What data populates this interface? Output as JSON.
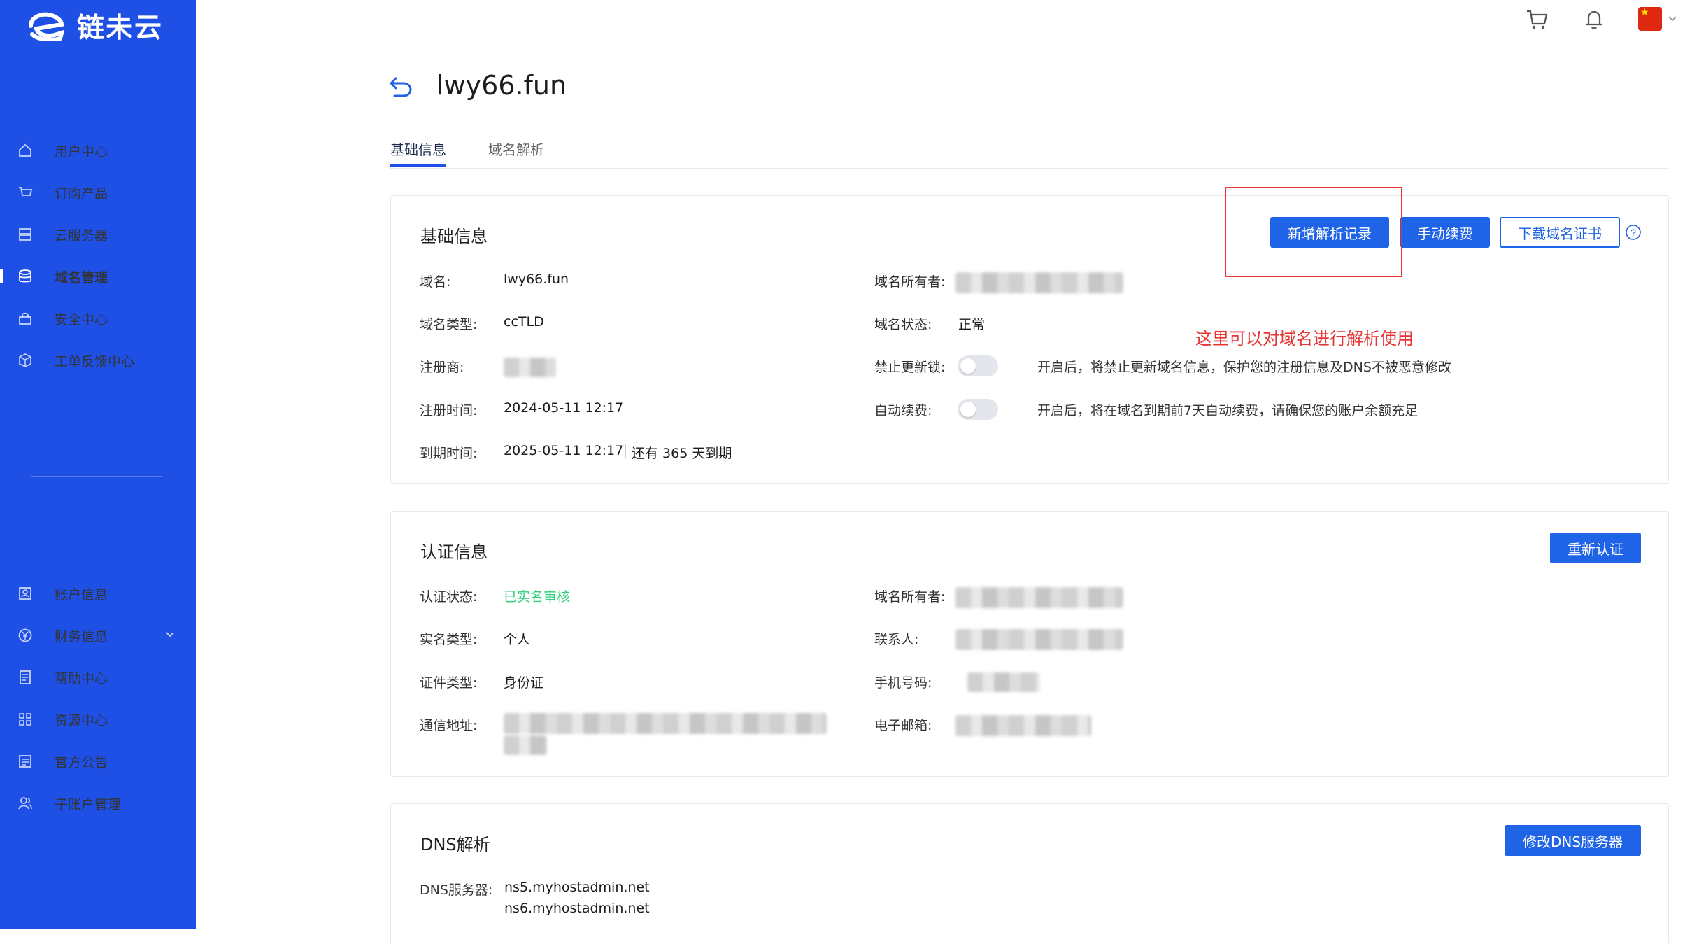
{
  "brand": {
    "name": "链未云"
  },
  "sidebar": {
    "items": [
      {
        "label": "用户中心",
        "icon": "home-icon"
      },
      {
        "label": "订购产品",
        "icon": "cart-icon"
      },
      {
        "label": "云服务器",
        "icon": "server-icon"
      },
      {
        "label": "域名管理",
        "icon": "database-icon",
        "active": true
      },
      {
        "label": "安全中心",
        "icon": "lock-icon"
      },
      {
        "label": "工单反馈中心",
        "icon": "cube-icon"
      }
    ],
    "bottom_items": [
      {
        "label": "账户信息",
        "icon": "id-card-icon"
      },
      {
        "label": "财务信息",
        "icon": "yuan-icon"
      },
      {
        "label": "帮助中心",
        "icon": "document-icon"
      },
      {
        "label": "资源中心",
        "icon": "grid-icon"
      },
      {
        "label": "官方公告",
        "icon": "notice-icon"
      },
      {
        "label": "子账户管理",
        "icon": "user-group-icon"
      }
    ]
  },
  "page": {
    "title": "lwy66.fun",
    "tabs": [
      {
        "label": "基础信息",
        "active": true
      },
      {
        "label": "域名解析"
      }
    ]
  },
  "basic": {
    "title": "基础信息",
    "buttons": {
      "add_record": "新增解析记录",
      "renew": "手动续费",
      "download_cert": "下载域名证书"
    },
    "fields": {
      "domain_label": "域名:",
      "domain_value": "lwy66.fun",
      "type_label": "域名类型:",
      "type_value": "ccTLD",
      "registrar_label": "注册商:",
      "reg_time_label": "注册时间:",
      "reg_time_value": "2024-05-11 12:17",
      "exp_time_label": "到期时间:",
      "exp_time_value": "2025-05-11 12:17",
      "remaining": "还有 365 天到期",
      "owner_label": "域名所有者:",
      "status_label": "域名状态:",
      "status_value": "正常",
      "lock_label": "禁止更新锁:",
      "lock_hint": "开启后，将禁止更新域名信息，保护您的注册信息及DNS不被恶意修改",
      "auto_label": "自动续费:",
      "auto_hint": "开启后，将在域名到期前7天自动续费，请确保您的账户余额充足"
    }
  },
  "annotation": {
    "text": "这里可以对域名进行解析使用",
    "color": "#e53535"
  },
  "auth": {
    "title": "认证信息",
    "button": "重新认证",
    "fields": {
      "status_label": "认证状态:",
      "status_value": "已实名审核",
      "type_label": "实名类型:",
      "type_value": "个人",
      "id_type_label": "证件类型:",
      "id_type_value": "身份证",
      "address_label": "通信地址:",
      "owner_label": "域名所有者:",
      "contact_label": "联系人:",
      "phone_label": "手机号码:",
      "email_label": "电子邮箱:"
    }
  },
  "dns": {
    "title": "DNS解析",
    "button": "修改DNS服务器",
    "server_label": "DNS服务器:",
    "servers": [
      "ns5.myhostadmin.net",
      "ns6.myhostadmin.net"
    ]
  },
  "colors": {
    "sidebar": "#1f50e6",
    "primary": "#1f63e6",
    "success": "#2fcf7c",
    "annotation": "#e53535"
  }
}
